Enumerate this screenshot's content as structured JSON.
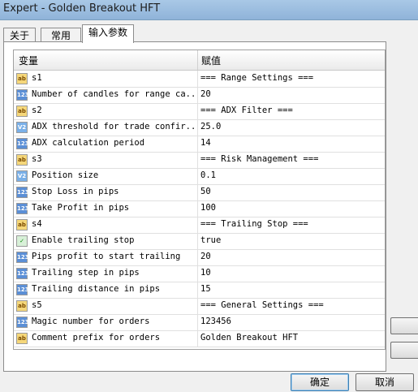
{
  "window": {
    "title": "Expert - Golden Breakout HFT"
  },
  "tabs": [
    {
      "label": "关于"
    },
    {
      "label": "常用"
    },
    {
      "label": "输入参数"
    }
  ],
  "grid": {
    "col_variable": "变量",
    "col_value": "赋值",
    "rows": [
      {
        "icon": "ab",
        "name": "s1",
        "value": "=== Range Settings ==="
      },
      {
        "icon": "123",
        "name": "Number of candles for range ca...",
        "value": "20"
      },
      {
        "icon": "ab",
        "name": "s2",
        "value": "=== ADX Filter ==="
      },
      {
        "icon": "v2",
        "name": "ADX threshold for trade confir...",
        "value": "25.0"
      },
      {
        "icon": "123",
        "name": "ADX calculation period",
        "value": "14"
      },
      {
        "icon": "ab",
        "name": "s3",
        "value": "=== Risk Management ==="
      },
      {
        "icon": "v2",
        "name": "Position size",
        "value": "0.1"
      },
      {
        "icon": "123",
        "name": "Stop Loss in pips",
        "value": "50"
      },
      {
        "icon": "123",
        "name": "Take Profit in pips",
        "value": "100"
      },
      {
        "icon": "ab",
        "name": "s4",
        "value": "=== Trailing Stop ==="
      },
      {
        "icon": "bool",
        "name": "Enable trailing stop",
        "value": "true"
      },
      {
        "icon": "123",
        "name": "Pips profit to start trailing",
        "value": "20"
      },
      {
        "icon": "123",
        "name": "Trailing step in pips",
        "value": "10"
      },
      {
        "icon": "123",
        "name": "Trailing distance in pips",
        "value": "15"
      },
      {
        "icon": "ab",
        "name": "s5",
        "value": "=== General Settings ==="
      },
      {
        "icon": "123",
        "name": "Magic number for orders",
        "value": "123456"
      },
      {
        "icon": "ab",
        "name": "Comment prefix for orders",
        "value": "Golden Breakout HFT"
      }
    ]
  },
  "buttons": {
    "ok": "确定",
    "cancel": "取消"
  }
}
